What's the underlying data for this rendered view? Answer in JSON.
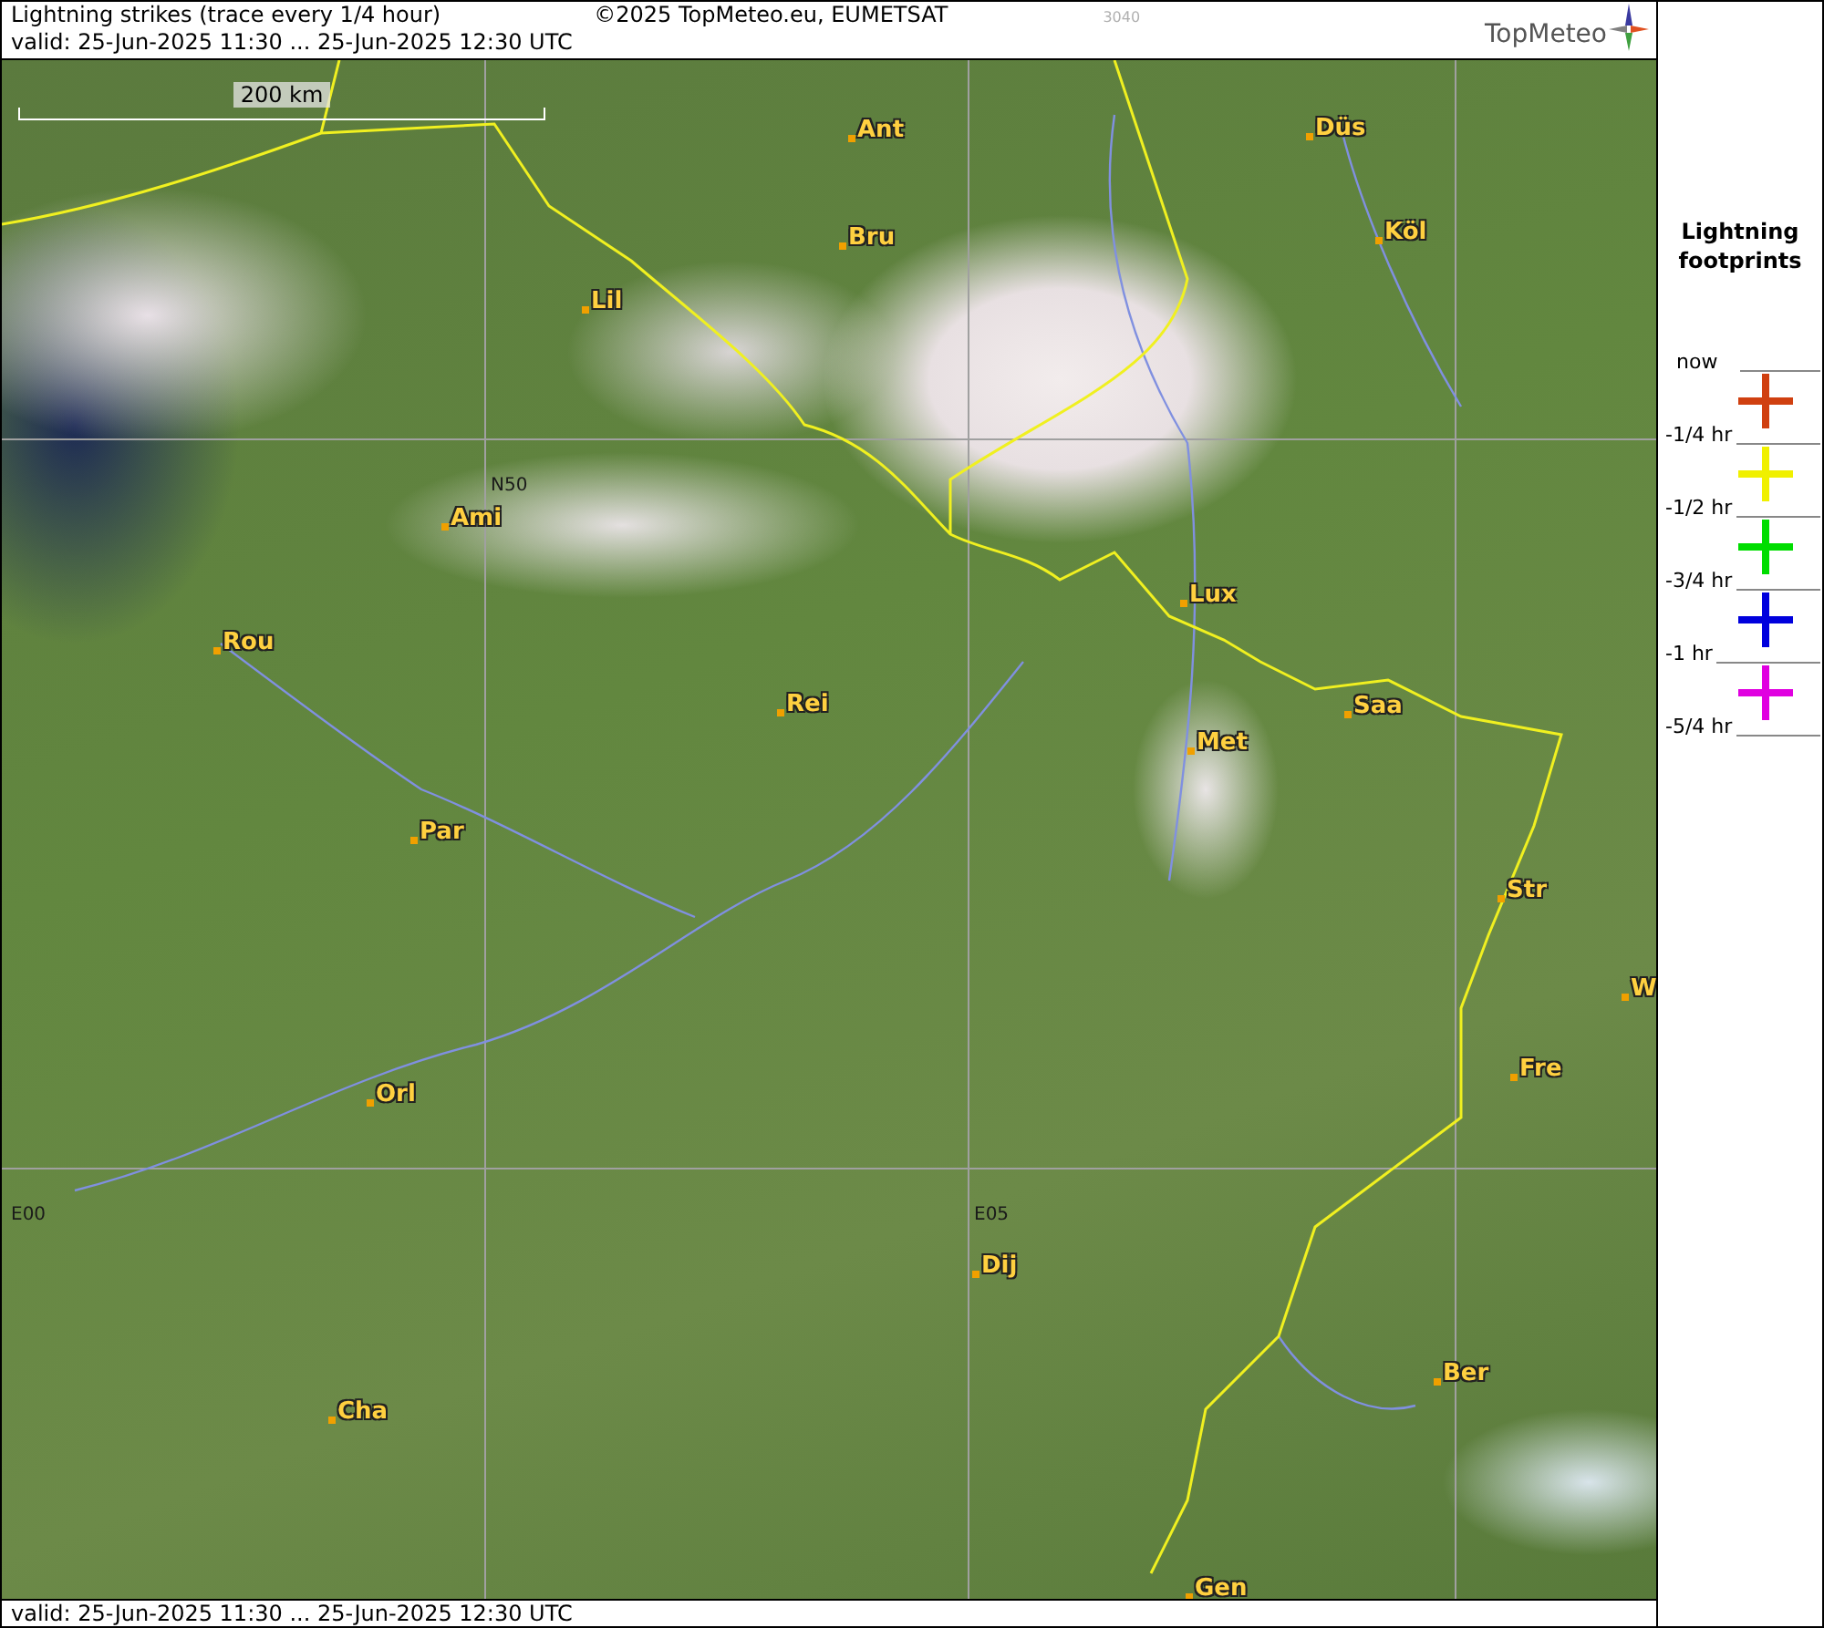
{
  "header": {
    "title": "Lightning strikes (trace every 1/4 hour)",
    "copyright": "©2025 TopMeteo.eu, EUMETSAT",
    "code": "3040",
    "valid": "valid:  25-Jun-2025 11:30 ... 25-Jun-2025 12:30 UTC",
    "logo": "TopMeteo"
  },
  "map": {
    "scale_label": "200 km",
    "grid_labels": [
      {
        "text": "N50"
      },
      {
        "text": "E00"
      },
      {
        "text": "E05"
      }
    ],
    "cities": [
      {
        "name": "Ant"
      },
      {
        "name": "Düs"
      },
      {
        "name": "Bru"
      },
      {
        "name": "Köl"
      },
      {
        "name": "Lil"
      },
      {
        "name": "Ami"
      },
      {
        "name": "Rou"
      },
      {
        "name": "Lux"
      },
      {
        "name": "Rei"
      },
      {
        "name": "Saa"
      },
      {
        "name": "Met"
      },
      {
        "name": "Par"
      },
      {
        "name": "Str"
      },
      {
        "name": "W"
      },
      {
        "name": "Fre"
      },
      {
        "name": "Orl"
      },
      {
        "name": "Dij"
      },
      {
        "name": "Ber"
      },
      {
        "name": "Cha"
      },
      {
        "name": "Gen"
      }
    ]
  },
  "footer": {
    "valid": "valid:  25-Jun-2025 11:30 ... 25-Jun-2025 12:30 UTC"
  },
  "legend": {
    "title": "Lightning footprints",
    "levels": [
      {
        "label": "now"
      },
      {
        "label": "-1/4 hr"
      },
      {
        "label": "-1/2 hr"
      },
      {
        "label": "-3/4 hr"
      },
      {
        "label": "-1 hr"
      },
      {
        "label": "-5/4 hr"
      }
    ],
    "crosses": [
      {
        "color": "#d04010"
      },
      {
        "color": "#f0f000"
      },
      {
        "color": "#00dd00"
      },
      {
        "color": "#0000dd"
      },
      {
        "color": "#e000e0"
      }
    ]
  }
}
